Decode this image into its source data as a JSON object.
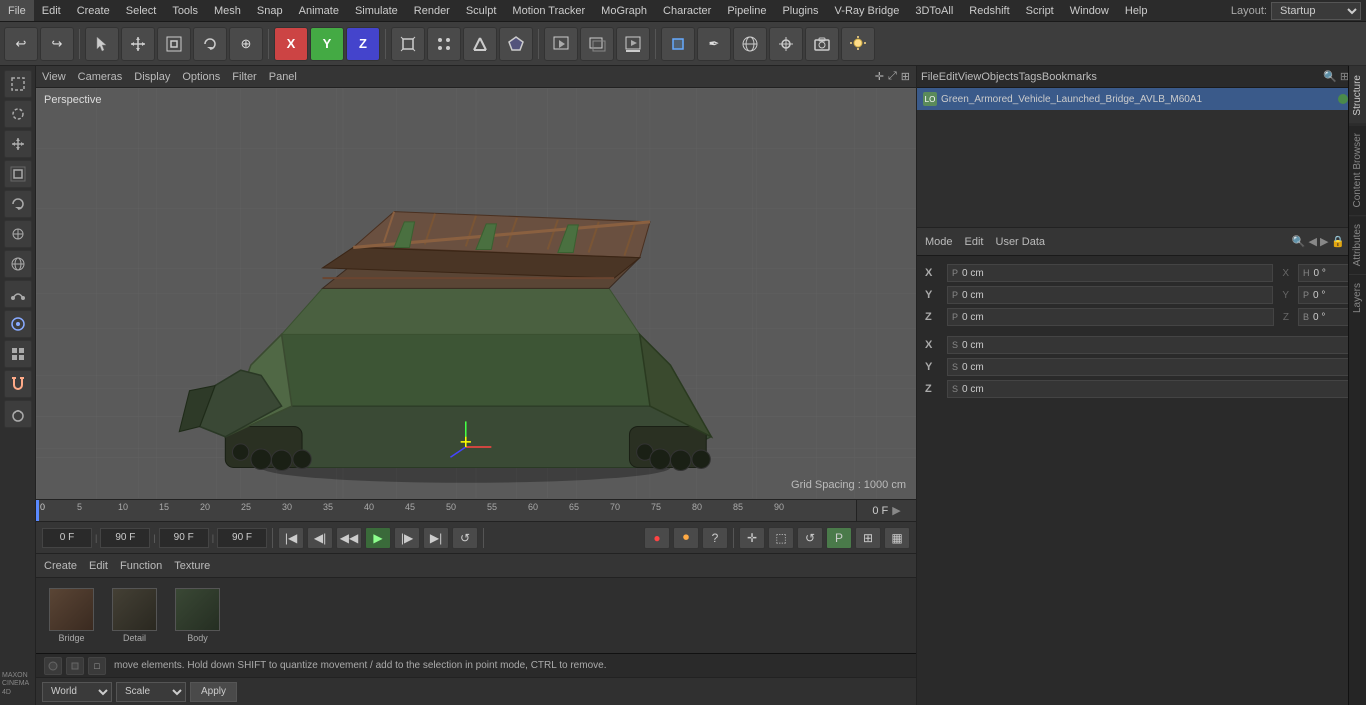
{
  "app": {
    "title": "Cinema 4D"
  },
  "top_menu": {
    "items": [
      "File",
      "Edit",
      "Create",
      "Select",
      "Tools",
      "Mesh",
      "Snap",
      "Animate",
      "Simulate",
      "Render",
      "Sculpt",
      "Motion Tracker",
      "MoGraph",
      "Character",
      "Pipeline",
      "Plugins",
      "V-Ray Bridge",
      "3DToAll",
      "Redshift",
      "Script",
      "Window",
      "Help"
    ],
    "layout_label": "Layout:",
    "layout_value": "Startup"
  },
  "toolbar": {
    "undo_icon": "↩",
    "redo_icon": "↪",
    "tools": [
      "⊕",
      "✛",
      "⬚",
      "↺",
      "⊕"
    ],
    "axis_x": "X",
    "axis_y": "Y",
    "axis_z": "Z",
    "object_mode": "□",
    "camera": "📷"
  },
  "viewport": {
    "header_items": [
      "View",
      "Cameras",
      "Display",
      "Options",
      "Filter",
      "Panel"
    ],
    "perspective_label": "Perspective",
    "grid_spacing": "Grid Spacing : 1000 cm"
  },
  "timeline": {
    "marks": [
      "0",
      "5",
      "10",
      "15",
      "20",
      "25",
      "30",
      "35",
      "40",
      "45",
      "50",
      "55",
      "60",
      "65",
      "70",
      "75",
      "80",
      "85",
      "90"
    ],
    "frame_label": "0 F",
    "start_frame": "0 F",
    "end_frame": "90 F",
    "current": "90 F",
    "preview_start": "90 F"
  },
  "playback": {
    "start_frame": "0 F",
    "end_frame": "90 F",
    "preview_start": "90 F",
    "preview_end": "90 F"
  },
  "objects_panel": {
    "header_items": [
      "File",
      "Edit",
      "View",
      "Objects",
      "Tags",
      "Bookmarks"
    ],
    "object_name": "Green_Armored_Vehicle_Launched_Bridge_AVLB_M60A1"
  },
  "attributes_panel": {
    "header_items": [
      "Mode",
      "Edit",
      "User Data"
    ],
    "coords": {
      "x_pos": "0 cm",
      "y_pos": "0 cm",
      "z_pos": "0 cm",
      "x_scale": "0 cm",
      "y_scale": "0 cm",
      "z_scale": "0 cm",
      "x_rot": "0 °",
      "y_rot": "0 °",
      "z_rot": "0 °",
      "h": "0 °",
      "p": "0 °",
      "b": "0 °"
    }
  },
  "materials": {
    "header_items": [
      "Create",
      "Edit",
      "Function",
      "Texture"
    ],
    "swatches": [
      {
        "label": "Bridge",
        "color": "#4a4a3a"
      },
      {
        "label": "Detail",
        "color": "#3a3a3a"
      },
      {
        "label": "Body",
        "color": "#383830"
      }
    ]
  },
  "world_bar": {
    "coord_system": "World",
    "transform_mode": "Scale",
    "apply_label": "Apply"
  },
  "status_bar": {
    "message": "move elements. Hold down SHIFT to quantize movement / add to the selection in point mode, CTRL to remove."
  }
}
